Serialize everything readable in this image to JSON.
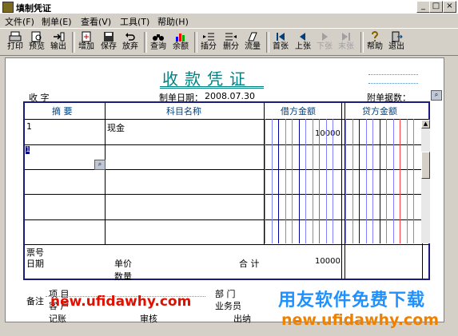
{
  "window": {
    "title": "填制凭证",
    "minimize": "_",
    "maximize": "□",
    "close": "×"
  },
  "menu": [
    "文件(F)",
    "制单(E)",
    "查看(V)",
    "工具(T)",
    "帮助(H)"
  ],
  "toolbar": {
    "print": "打印",
    "preview": "预览",
    "export": "输出",
    "add": "增加",
    "save": "保存",
    "discard": "放弃",
    "query": "查询",
    "balance": "余额",
    "insert": "插分",
    "delete": "删分",
    "flow": "流量",
    "first": "首张",
    "prev": "上张",
    "next": "下张",
    "last": "末张",
    "help": "帮助",
    "exit": "退出"
  },
  "voucher": {
    "title": "收款凭证",
    "type_label": "收  字",
    "date_label": "制单日期：",
    "date_value": "2008.07.30",
    "attachments_label": "附单据数："
  },
  "table": {
    "headers": {
      "summary": "摘  要",
      "account": "科目名称",
      "debit": "借方金额",
      "credit": "贷方金额"
    },
    "rows": [
      {
        "summary": "1",
        "account": "现金",
        "debit": "10000",
        "credit": ""
      },
      {
        "summary": "1",
        "account": "",
        "debit": "",
        "credit": ""
      },
      {
        "summary": "",
        "account": "",
        "debit": "",
        "credit": ""
      },
      {
        "summary": "",
        "account": "",
        "debit": "",
        "credit": ""
      }
    ],
    "footer": {
      "ticket_label": "票号",
      "date_label": "日期",
      "unit_price_label": "单价",
      "quantity_label": "数量",
      "total_label": "合 计",
      "total_debit": "10000"
    }
  },
  "notes": {
    "remark_label": "备注",
    "project_label": "项  目",
    "customer_label": "客  户",
    "department_label": "部  门",
    "salesman_label": "业务员"
  },
  "signatures": {
    "bookkeeper": "记账",
    "auditor": "审核",
    "cashier": "出纳"
  },
  "watermark": {
    "cn": "用友软件免费下载",
    "url_orange": "new.ufidawhy.com",
    "url_red": "new.ufidawhy.com"
  }
}
